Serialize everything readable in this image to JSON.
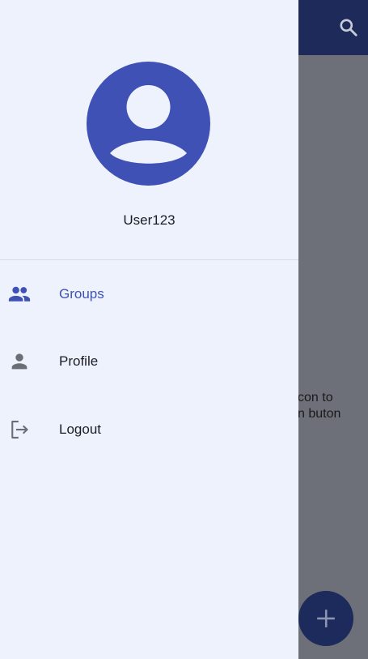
{
  "drawer": {
    "username": "User123",
    "items": [
      {
        "label": "Groups",
        "icon": "group-icon",
        "active": true
      },
      {
        "label": "Profile",
        "icon": "person-icon",
        "active": false
      },
      {
        "label": "Logout",
        "icon": "logout-icon",
        "active": false
      }
    ]
  },
  "background": {
    "hint_line1": "con to",
    "hint_line2": "n buton"
  },
  "colors": {
    "accent": "#3f51b5",
    "appbar": "#1d2a5a",
    "drawer_bg": "#edf2fd",
    "scrim": "#6e7079",
    "text": "#1c1d22",
    "icon_gray": "#6b6e75"
  }
}
